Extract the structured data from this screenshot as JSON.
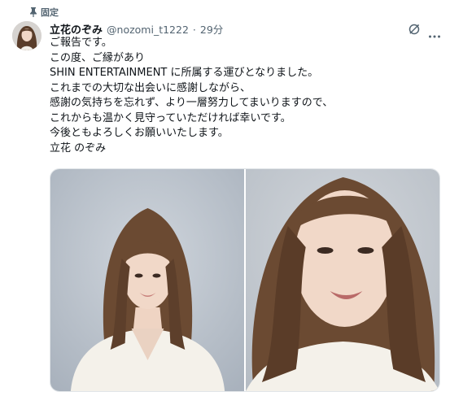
{
  "pinned": {
    "label": "固定"
  },
  "author": {
    "display_name": "立花のぞみ",
    "handle": "@nozomi_t1222",
    "separator": "·",
    "time": "29分"
  },
  "body_lines": [
    "ご報告です。",
    "この度、ご縁があり",
    "SHIN ENTERTAINMENT に所属する運びとなりました。",
    "これまでの大切な出会いに感謝しながら、",
    "感謝の気持ちを忘れず、より一層努力してまいりますので、",
    "これからも温かく見守っていただければ幸いです。",
    "今後ともよろしくお願いいたします。",
    "立花 のぞみ"
  ],
  "icons": {
    "pin": "pin-icon",
    "grok": "grok-icon",
    "more": "more-icon"
  },
  "colors": {
    "text_primary": "#0f1419",
    "text_secondary": "#536471",
    "photo_bg_left": "#b9c1cc",
    "photo_bg_right": "#c4c9cf",
    "hair": "#6b4a32",
    "skin": "#f1d8c8",
    "shirt": "#f4f1ea"
  }
}
